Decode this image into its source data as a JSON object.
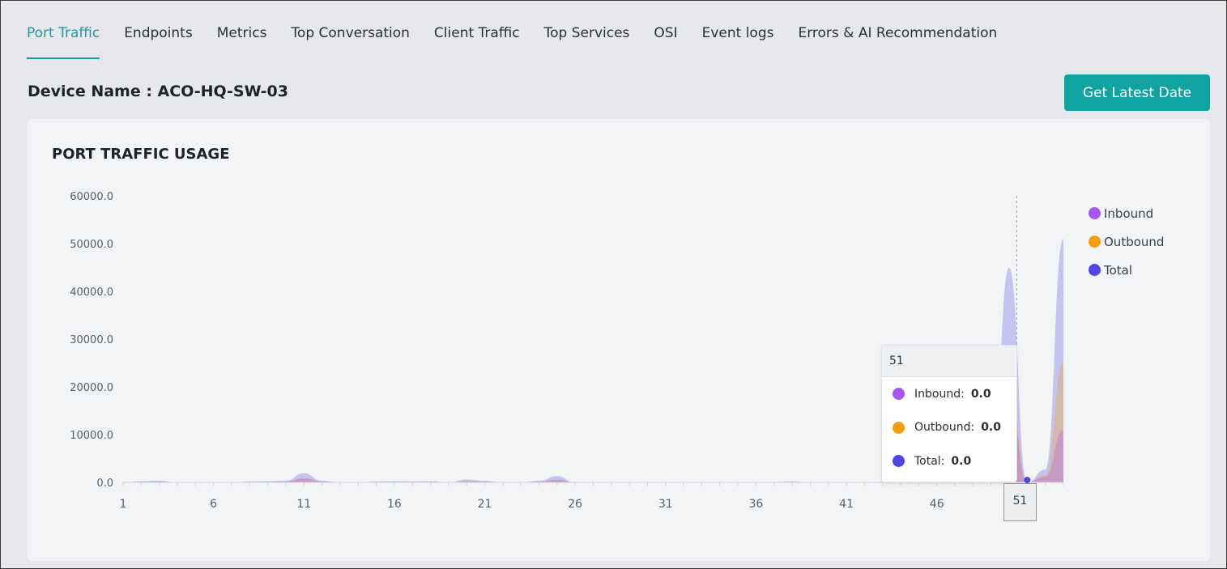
{
  "tabs": [
    {
      "label": "Port Traffic",
      "active": true
    },
    {
      "label": "Endpoints",
      "active": false
    },
    {
      "label": "Metrics",
      "active": false
    },
    {
      "label": "Top Conversation",
      "active": false
    },
    {
      "label": "Client Traffic",
      "active": false
    },
    {
      "label": "Top Services",
      "active": false
    },
    {
      "label": "OSI",
      "active": false
    },
    {
      "label": "Event logs",
      "active": false
    },
    {
      "label": "Errors & AI Recommendation",
      "active": false
    }
  ],
  "device_title": "Device Name : ACO-HQ-SW-03",
  "get_latest_button": "Get Latest Date",
  "card_title": "PORT TRAFFIC USAGE",
  "legend": [
    {
      "label": "Inbound",
      "color": "#a855f7"
    },
    {
      "label": "Outbound",
      "color": "#f59e0b"
    },
    {
      "label": "Total",
      "color": "#4f46e5"
    }
  ],
  "tooltip": {
    "x_label": "51",
    "rows": [
      {
        "label": "Inbound:",
        "value": "0.0",
        "color": "#a855f7"
      },
      {
        "label": "Outbound:",
        "value": "0.0",
        "color": "#f59e0b"
      },
      {
        "label": "Total:",
        "value": "0.0",
        "color": "#4f46e5"
      }
    ]
  },
  "hover_x_label": "51",
  "chart_data": {
    "type": "area",
    "title": "PORT TRAFFIC USAGE",
    "xlabel": "",
    "ylabel": "",
    "ylim": [
      0,
      60000
    ],
    "yticks": [
      "60000.0",
      "50000.0",
      "40000.0",
      "30000.0",
      "20000.0",
      "10000.0",
      "0.0"
    ],
    "xtick_labels": [
      "1",
      "6",
      "11",
      "16",
      "21",
      "26",
      "31",
      "36",
      "41",
      "46"
    ],
    "x": [
      1,
      2,
      3,
      4,
      5,
      6,
      7,
      8,
      9,
      10,
      11,
      12,
      13,
      14,
      15,
      16,
      17,
      18,
      19,
      20,
      21,
      22,
      23,
      24,
      25,
      26,
      27,
      28,
      29,
      30,
      31,
      32,
      33,
      34,
      35,
      36,
      37,
      38,
      39,
      40,
      41,
      42,
      43,
      44,
      45,
      46,
      47,
      48,
      49,
      50,
      51,
      52,
      53
    ],
    "series": [
      {
        "name": "Inbound",
        "color": "#a855f7",
        "values": [
          0,
          150,
          200,
          0,
          0,
          0,
          0,
          100,
          150,
          200,
          800,
          200,
          0,
          0,
          100,
          150,
          100,
          100,
          0,
          200,
          200,
          0,
          0,
          150,
          500,
          0,
          0,
          0,
          0,
          0,
          0,
          0,
          0,
          0,
          0,
          0,
          50,
          100,
          0,
          0,
          0,
          0,
          0,
          0,
          0,
          0,
          0,
          0,
          0,
          18000,
          0,
          1200,
          11000
        ]
      },
      {
        "name": "Outbound",
        "color": "#f59e0b",
        "values": [
          0,
          100,
          150,
          0,
          0,
          0,
          0,
          100,
          100,
          150,
          900,
          150,
          0,
          0,
          100,
          100,
          100,
          150,
          0,
          300,
          150,
          0,
          0,
          200,
          600,
          0,
          0,
          0,
          0,
          0,
          0,
          0,
          0,
          0,
          0,
          0,
          50,
          100,
          0,
          0,
          0,
          0,
          0,
          0,
          0,
          0,
          0,
          0,
          0,
          22000,
          0,
          1500,
          25000
        ]
      },
      {
        "name": "Total",
        "color": "#4f46e5",
        "values": [
          0,
          250,
          350,
          0,
          0,
          0,
          0,
          200,
          250,
          350,
          1900,
          350,
          0,
          0,
          200,
          250,
          200,
          250,
          0,
          600,
          350,
          0,
          0,
          350,
          1300,
          0,
          0,
          0,
          0,
          0,
          0,
          0,
          0,
          0,
          0,
          0,
          100,
          200,
          0,
          0,
          0,
          0,
          0,
          0,
          0,
          0,
          0,
          0,
          0,
          45000,
          0,
          2700,
          51000
        ]
      }
    ],
    "legend_position": "top-right",
    "grid": false
  }
}
